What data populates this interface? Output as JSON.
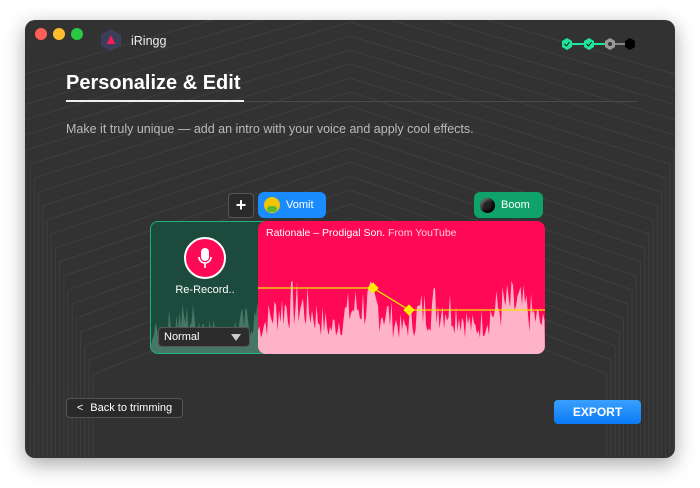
{
  "app": {
    "name": "iRingg"
  },
  "steps": [
    {
      "state": "done"
    },
    {
      "state": "done"
    },
    {
      "state": "current"
    },
    {
      "state": "pending"
    }
  ],
  "page": {
    "title": "Personalize & Edit",
    "subtitle": "Make it truly unique — add an intro with your voice and apply cool effects."
  },
  "effects": {
    "add_label": "+",
    "items": [
      {
        "label": "Vomit",
        "icon": "nauseated-face-icon",
        "color": "#1a8cff"
      },
      {
        "label": "Boom",
        "icon": "bomb-icon",
        "color": "#0fa36a"
      }
    ]
  },
  "recorder": {
    "label": "Re-Record..",
    "mode": "Normal"
  },
  "track": {
    "title": "Rationale – Prodigal Son.",
    "source": "From YouTube",
    "color": "#ff0855"
  },
  "footer": {
    "back_label": "Back to trimming",
    "export_label": "EXPORT"
  }
}
